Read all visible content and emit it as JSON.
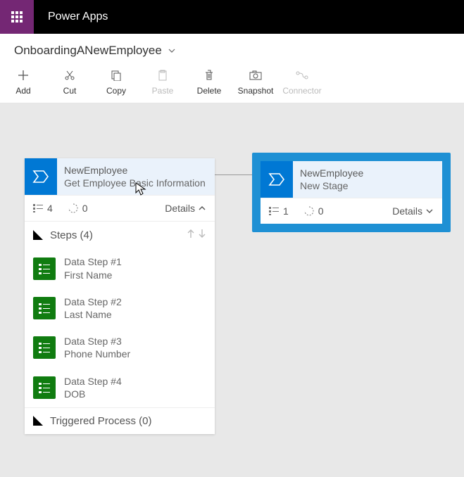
{
  "header": {
    "app_title": "Power Apps"
  },
  "flow": {
    "name": "OnboardingANewEmployee"
  },
  "toolbar": {
    "add": "Add",
    "cut": "Cut",
    "copy": "Copy",
    "paste": "Paste",
    "delete": "Delete",
    "snapshot": "Snapshot",
    "connector": "Connector"
  },
  "stage1": {
    "entity": "NewEmployee",
    "title": "Get Employee Basic Information",
    "step_count": "4",
    "process_count": "0",
    "details_label": "Details",
    "steps_header": "Steps (4)",
    "steps": [
      {
        "name": "Data Step #1",
        "field": "First Name"
      },
      {
        "name": "Data Step #2",
        "field": "Last Name"
      },
      {
        "name": "Data Step #3",
        "field": "Phone Number"
      },
      {
        "name": "Data Step #4",
        "field": "DOB"
      }
    ],
    "triggered_header": "Triggered Process (0)"
  },
  "stage2": {
    "entity": "NewEmployee",
    "title": "New Stage",
    "step_count": "1",
    "process_count": "0",
    "details_label": "Details"
  }
}
